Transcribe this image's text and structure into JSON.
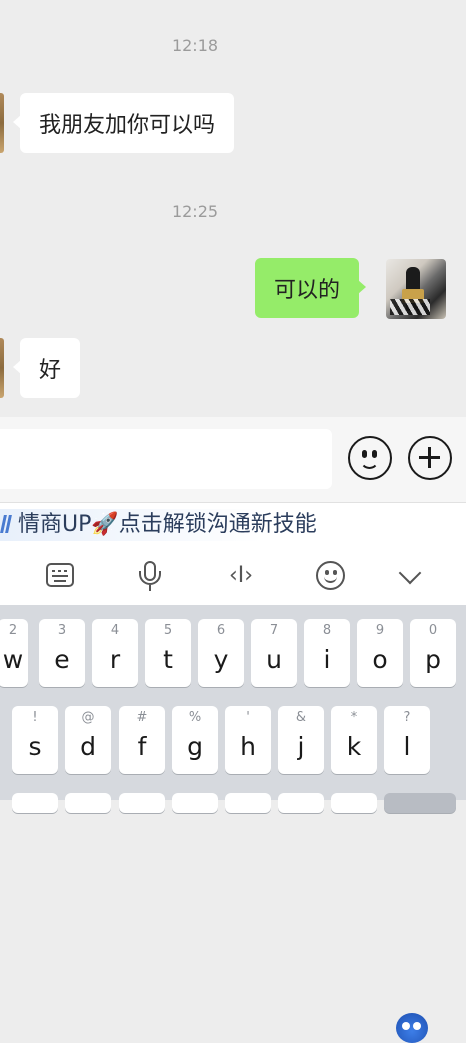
{
  "chat": {
    "time1": "12:18",
    "msg1": "我朋友加你可以吗",
    "time2": "12:25",
    "msg2": "可以的",
    "msg3": "好"
  },
  "input": {
    "emoji_icon": "smiley-icon",
    "plus_icon": "plus-icon"
  },
  "ad": {
    "text": "情商UP🚀点击解锁沟通新技能",
    "mascot_icon": "mascot-icon"
  },
  "toolbar": [
    "keyboard-icon",
    "microphone-icon",
    "cursor-icon",
    "emoji-face-icon",
    "chevron-down-icon"
  ],
  "toolbar_cursor_glyph": "‹I›",
  "keyboard": {
    "row1": [
      {
        "hint": "2",
        "ch": "w"
      },
      {
        "hint": "3",
        "ch": "e"
      },
      {
        "hint": "4",
        "ch": "r"
      },
      {
        "hint": "5",
        "ch": "t"
      },
      {
        "hint": "6",
        "ch": "y"
      },
      {
        "hint": "7",
        "ch": "u"
      },
      {
        "hint": "8",
        "ch": "i"
      },
      {
        "hint": "9",
        "ch": "o"
      },
      {
        "hint": "0",
        "ch": "p"
      }
    ],
    "row2": [
      {
        "hint": "!",
        "ch": "s"
      },
      {
        "hint": "@",
        "ch": "d"
      },
      {
        "hint": "#",
        "ch": "f"
      },
      {
        "hint": "%",
        "ch": "g"
      },
      {
        "hint": "'",
        "ch": "h"
      },
      {
        "hint": "&",
        "ch": "j"
      },
      {
        "hint": "*",
        "ch": "k"
      },
      {
        "hint": "?",
        "ch": "l"
      }
    ]
  },
  "colors": {
    "sent_bubble": "#95ec69",
    "received_bubble": "#ffffff",
    "chat_bg": "#ededed",
    "keyboard_bg": "#d6d9de"
  }
}
